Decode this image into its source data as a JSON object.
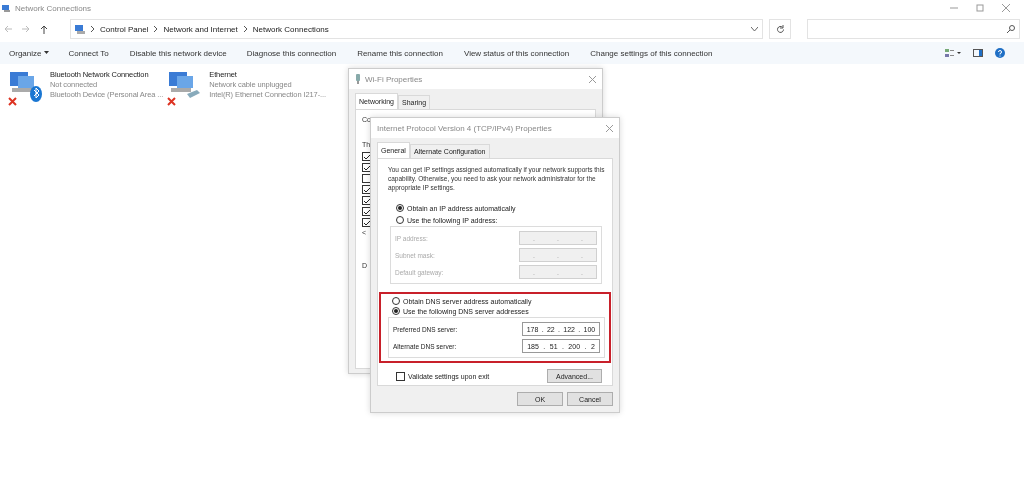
{
  "window": {
    "title": "Network Connections"
  },
  "address_bar": {
    "path": [
      "Control Panel",
      "Network and Internet",
      "Network Connections"
    ]
  },
  "toolbar": [
    "Organize",
    "Connect To",
    "Disable this network device",
    "Diagnose this connection",
    "Rename this connection",
    "View status of this connection",
    "Change settings of this connection"
  ],
  "connections": [
    {
      "name": "Bluetooth Network Connection",
      "status": "Not connected",
      "device": "Bluetooth Device (Personal Area ...",
      "kind": "bluetooth",
      "error": true
    },
    {
      "name": "Ethernet",
      "status": "Network cable unplugged",
      "device": "Intel(R) Ethernet Connection I217-...",
      "kind": "ethernet",
      "error": true
    }
  ],
  "wifi_dialog": {
    "title": "Wi-Fi Properties",
    "tabs": [
      {
        "label": "Networking",
        "selected": true
      },
      {
        "label": "Sharing",
        "selected": false
      }
    ],
    "connect_label": "Co",
    "items_label": "Th",
    "description_label": "D",
    "items": [
      {
        "checked": true
      },
      {
        "checked": true
      },
      {
        "checked": false
      },
      {
        "checked": true
      },
      {
        "checked": true
      },
      {
        "checked": true
      },
      {
        "checked": true
      }
    ],
    "scroll_left": "<"
  },
  "ipv4_dialog": {
    "title": "Internet Protocol Version 4 (TCP/IPv4) Properties",
    "tabs": [
      {
        "label": "General",
        "selected": true
      },
      {
        "label": "Alternate Configuration",
        "selected": false
      }
    ],
    "intro": "You can get IP settings assigned automatically if your network supports this capability. Otherwise, you need to ask your network administrator for the appropriate IP settings.",
    "ip_options": [
      {
        "label": "Obtain an IP address automatically",
        "selected": true
      },
      {
        "label": "Use the following IP address:",
        "selected": false
      }
    ],
    "ip_fields": [
      {
        "label": "IP address:",
        "disabled": true
      },
      {
        "label": "Subnet mask:",
        "disabled": true
      },
      {
        "label": "Default gateway:",
        "disabled": true
      }
    ],
    "octet_separator": ".",
    "dns_options": [
      {
        "label": "Obtain DNS server address automatically",
        "selected": false
      },
      {
        "label": "Use the following DNS server addresses",
        "selected": true
      }
    ],
    "dns_highlighted": true,
    "dns_fields": [
      {
        "label": "Preferred DNS server:",
        "octets": [
          "178",
          "22",
          "122",
          "100"
        ]
      },
      {
        "label": "Alternate DNS server:",
        "octets": [
          "185",
          "51",
          "200",
          "2"
        ]
      }
    ],
    "validate": {
      "label": "Validate settings upon exit",
      "checked": false
    },
    "advanced_button": "Advanced...",
    "buttons": [
      "OK",
      "Cancel"
    ]
  }
}
